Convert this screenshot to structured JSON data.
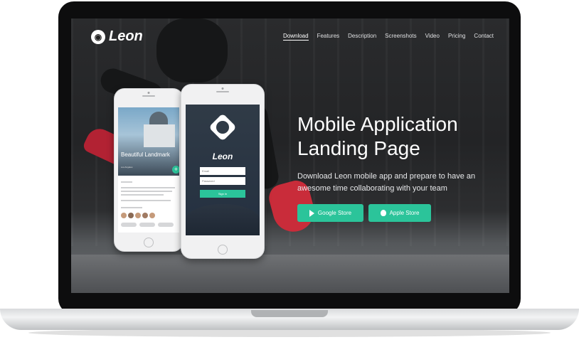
{
  "nav": {
    "logo_text": "Leon",
    "logo_icon": "lion-logo-icon",
    "items": [
      {
        "label": "Download",
        "active": true
      },
      {
        "label": "Features",
        "active": false
      },
      {
        "label": "Description",
        "active": false
      },
      {
        "label": "Screenshots",
        "active": false
      },
      {
        "label": "Video",
        "active": false
      },
      {
        "label": "Pricing",
        "active": false
      },
      {
        "label": "Contact",
        "active": false
      }
    ]
  },
  "hero": {
    "title_line1": "Mobile Application",
    "title_line2": "Landing Page",
    "subtitle": "Download Leon mobile app and prepare to have an awesome time collaborating with your team",
    "google_btn": "Google Store",
    "apple_btn": "Apple Store"
  },
  "phone_back": {
    "title": "Beautiful Landmark",
    "location": "Los Angeles"
  },
  "phone_front": {
    "logo_text": "Leon",
    "email_placeholder": "Email",
    "password_placeholder": "Password",
    "signin": "Sign in"
  },
  "colors": {
    "accent": "#2bc49a",
    "screen_bg": "#232426",
    "laptop_frame": "#0d0d0e"
  }
}
